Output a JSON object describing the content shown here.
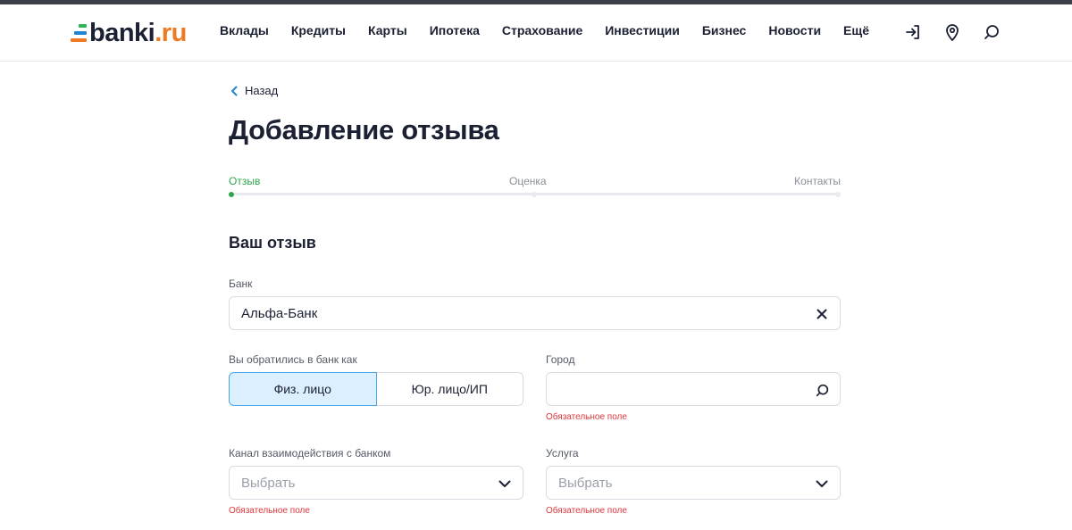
{
  "header": {
    "logo_text": "banki",
    "logo_suffix": ".ru",
    "nav": [
      "Вклады",
      "Кредиты",
      "Карты",
      "Ипотека",
      "Страхование",
      "Инвестиции",
      "Бизнес",
      "Новости",
      "Ещё"
    ],
    "icons": [
      "login-icon",
      "location-pin-icon",
      "search-icon"
    ]
  },
  "back_label": "Назад",
  "page_title": "Добавление отзыва",
  "steps": [
    {
      "label": "Отзыв",
      "active": true
    },
    {
      "label": "Оценка",
      "active": false
    },
    {
      "label": "Контакты",
      "active": false
    }
  ],
  "section_title": "Ваш отзыв",
  "bank": {
    "label": "Банк",
    "value": "Альфа-Банк"
  },
  "client_type": {
    "label": "Вы обратились в банк как",
    "options": [
      "Физ. лицо",
      "Юр. лицо/ИП"
    ],
    "selected": "Физ. лицо"
  },
  "city": {
    "label": "Город",
    "value": "",
    "error": "Обязательное поле"
  },
  "channel": {
    "label": "Канал взаимодействия с банком",
    "placeholder": "Выбрать",
    "error": "Обязательное поле"
  },
  "service": {
    "label": "Услуга",
    "placeholder": "Выбрать",
    "error": "Обязательное поле"
  },
  "colors": {
    "accent_green": "#2fa54f",
    "error_red": "#e0353a",
    "selected_bg": "#dcefff",
    "selected_border": "#4aa3e6"
  }
}
